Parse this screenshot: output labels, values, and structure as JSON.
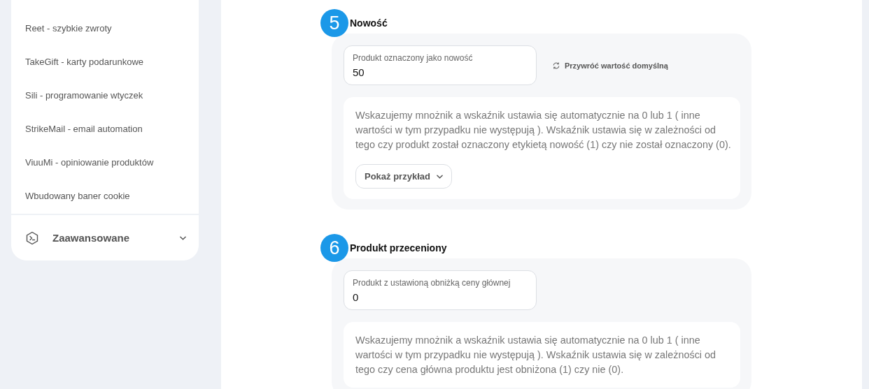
{
  "sidebar": {
    "items": [
      {
        "label": "Reet - szybkie zwroty"
      },
      {
        "label": "TakeGift - karty podarunkowe"
      },
      {
        "label": "Sili - programowanie wtyczek"
      },
      {
        "label": "StrikeMail - email automation"
      },
      {
        "label": "ViuuMi - opiniowanie produktów"
      },
      {
        "label": "Wbudowany baner cookie"
      }
    ],
    "group": {
      "label": "Zaawansowane",
      "expanded": false
    }
  },
  "sections": [
    {
      "number": "5",
      "title": "Nowość",
      "field_label": "Produkt oznaczony jako nowość",
      "value": "50",
      "reset": "Przywróć wartość domyślną",
      "description": "Wskazujemy mnożnik a wskaźnik ustawia się automatycznie na 0 lub 1 ( inne wartości w tym przypadku nie występują ). Wskaźnik ustawia się w zależności od tego czy produkt został oznaczony etykietą nowość (1) czy nie został oznaczony (0).",
      "example_button": "Pokaż przykład"
    },
    {
      "number": "6",
      "title": "Produkt przeceniony",
      "field_label": "Produkt z ustawioną obniżką ceny głównej",
      "value": "0",
      "description": "Wskazujemy mnożnik a wskaźnik ustawia się automatycznie na 0 lub 1 ( inne wartości w tym przypadku nie występują ). Wskaźnik ustawia się w zależności od tego czy cena główna produktu jest obniżona (1) czy nie (0)."
    }
  ]
}
